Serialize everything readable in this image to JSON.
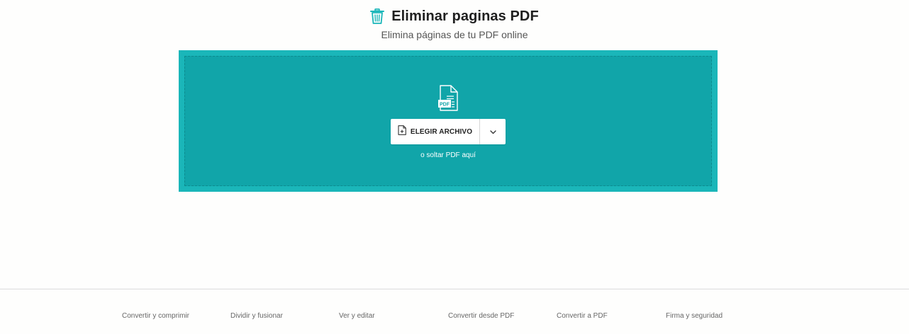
{
  "header": {
    "title": "Eliminar paginas PDF",
    "subtitle": "Elimina páginas de tu PDF online",
    "icon": "trash-icon"
  },
  "dropzone": {
    "file_icon": "pdf-file-icon",
    "file_icon_text": "PDF",
    "choose_button_label": "ELEGIR ARCHIVO",
    "choose_button_icon": "file-add-icon",
    "dropdown_icon": "chevron-down-icon",
    "drop_hint": "o soltar PDF aquí"
  },
  "footer": {
    "links": [
      "Convertir y comprimir",
      "Dividir y fusionar",
      "Ver y editar",
      "Convertir desde PDF",
      "Convertir a PDF",
      "Firma y seguridad"
    ]
  },
  "colors": {
    "accent": "#1ab6b9",
    "dropzone_fill": "#11a5a9",
    "background": "#fefefd"
  }
}
